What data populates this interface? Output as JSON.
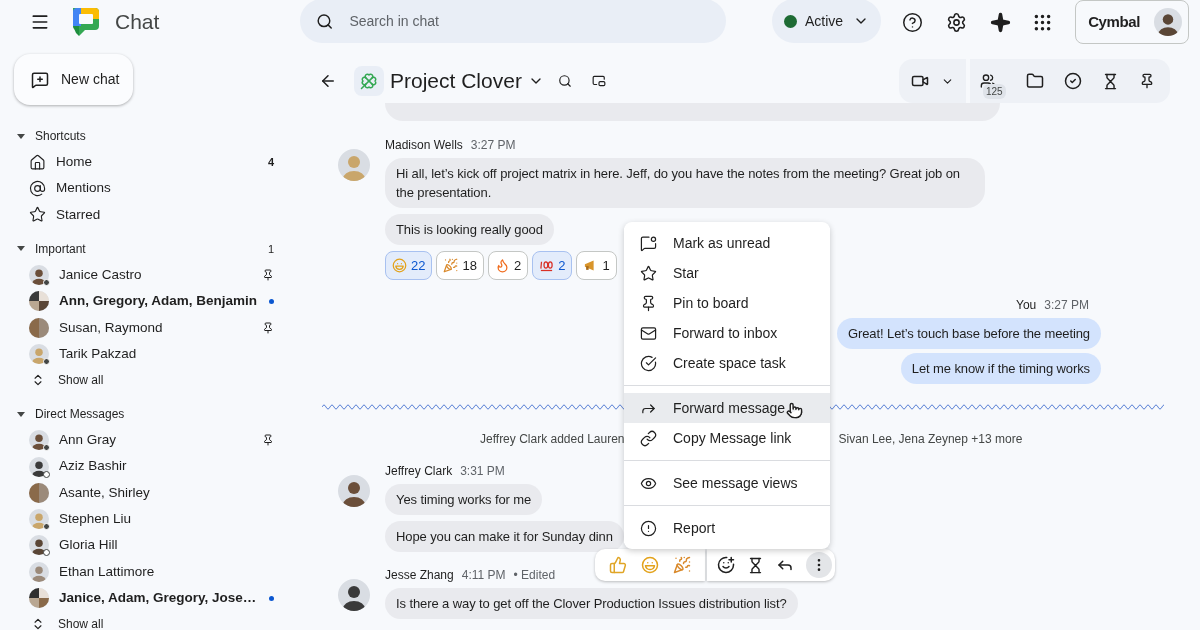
{
  "app": {
    "title": "Chat"
  },
  "search": {
    "placeholder": "Search in chat"
  },
  "status": {
    "label": "Active"
  },
  "account": {
    "brand": "Cymbal"
  },
  "new_chat": {
    "label": "New chat"
  },
  "sidebar": {
    "sections": [
      {
        "title": "Shortcuts",
        "items": [
          {
            "kind": "home",
            "label": "Home",
            "count": "4"
          },
          {
            "kind": "mentions",
            "label": "Mentions"
          },
          {
            "kind": "starred",
            "label": "Starred"
          }
        ]
      },
      {
        "title": "Important",
        "count": "1",
        "show_all": "Show all",
        "items": [
          {
            "kind": "person",
            "label": "Janice Castro",
            "online": true,
            "pinned": true,
            "unread": false
          },
          {
            "kind": "group",
            "label": "Ann, Gregory, Adam, Benjamin",
            "pinned": false,
            "unread": true
          },
          {
            "kind": "pair",
            "label": "Susan, Raymond",
            "pinned": true,
            "unread": false
          },
          {
            "kind": "person",
            "label": "Tarik Pakzad",
            "online": true,
            "pinned": false,
            "unread": false
          }
        ]
      },
      {
        "title": "Direct Messages",
        "show_all": "Show all",
        "items": [
          {
            "kind": "person",
            "label": "Ann Gray",
            "online": true,
            "pinned": true,
            "unread": false
          },
          {
            "kind": "person",
            "label": "Aziz Bashir",
            "online": false,
            "pinned": false,
            "unread": false
          },
          {
            "kind": "pair",
            "label": "Asante, Shirley",
            "pinned": false,
            "unread": false
          },
          {
            "kind": "person",
            "label": "Stephen Liu",
            "online": true,
            "pinned": false,
            "unread": false
          },
          {
            "kind": "person",
            "label": "Gloria Hill",
            "online": false,
            "pinned": false,
            "unread": false
          },
          {
            "kind": "person",
            "label": "Ethan Lattimore",
            "pinned": false,
            "unread": false
          },
          {
            "kind": "group",
            "label": "Janice, Adam, Gregory, Jose…",
            "pinned": false,
            "unread": true
          }
        ]
      }
    ]
  },
  "space": {
    "title": "Project Clover",
    "members": "125"
  },
  "messages": [
    {
      "kind": "partial"
    },
    {
      "kind": "incoming",
      "sender": "Madison Wells",
      "time": "3:27 PM",
      "bubbles": [
        "Hi all, let’s kick off project matrix in here. Jeff, do you have the notes from the meeting? Great job on the presentation.",
        "This is looking really good"
      ],
      "reactions": [
        {
          "kind": "laugh",
          "count": "22",
          "selected": true
        },
        {
          "kind": "party",
          "count": "18",
          "selected": false
        },
        {
          "kind": "fire",
          "count": "2",
          "selected": false
        },
        {
          "kind": "hundred",
          "count": "2",
          "selected": true
        },
        {
          "kind": "megaphone",
          "count": "1",
          "selected": false
        }
      ]
    },
    {
      "kind": "outgoing",
      "sender": "You",
      "time": "3:27 PM",
      "bubbles": [
        "Great! Let’s touch base before the meeting",
        "Let me know if the timing works"
      ]
    },
    {
      "kind": "divider"
    },
    {
      "kind": "system",
      "parts": [
        "Jeffrey Clark added Lauren",
        "Sivan Lee, Jena Zeynep +13 more"
      ]
    },
    {
      "kind": "incoming",
      "sender": "Jeffrey Clark",
      "time": "3:31 PM",
      "bubbles": [
        "Yes timing works for me",
        "Hope you can make it for Sunday dinn"
      ]
    },
    {
      "kind": "incoming",
      "sender": "Jesse Zhang",
      "time": "4:11 PM",
      "edited": "• Edited",
      "hovered": true,
      "bubbles": [
        "Is there a way to get off the Clover Production Issues distribution list?"
      ]
    }
  ],
  "menu": {
    "groups": [
      [
        {
          "kind": "unread",
          "label": "Mark as unread",
          "selected": false
        },
        {
          "kind": "star",
          "label": "Star",
          "selected": false
        },
        {
          "kind": "pin",
          "label": "Pin to board",
          "selected": false
        },
        {
          "kind": "inbox",
          "label": "Forward to inbox",
          "selected": false
        },
        {
          "kind": "task",
          "label": "Create space task",
          "selected": false
        }
      ],
      [
        {
          "kind": "forward",
          "label": "Forward message",
          "selected": true
        },
        {
          "kind": "link",
          "label": "Copy Message link",
          "selected": false
        }
      ],
      [
        {
          "kind": "views",
          "label": "See message views",
          "selected": false
        }
      ],
      [
        {
          "kind": "report",
          "label": "Report",
          "selected": false
        }
      ]
    ]
  }
}
